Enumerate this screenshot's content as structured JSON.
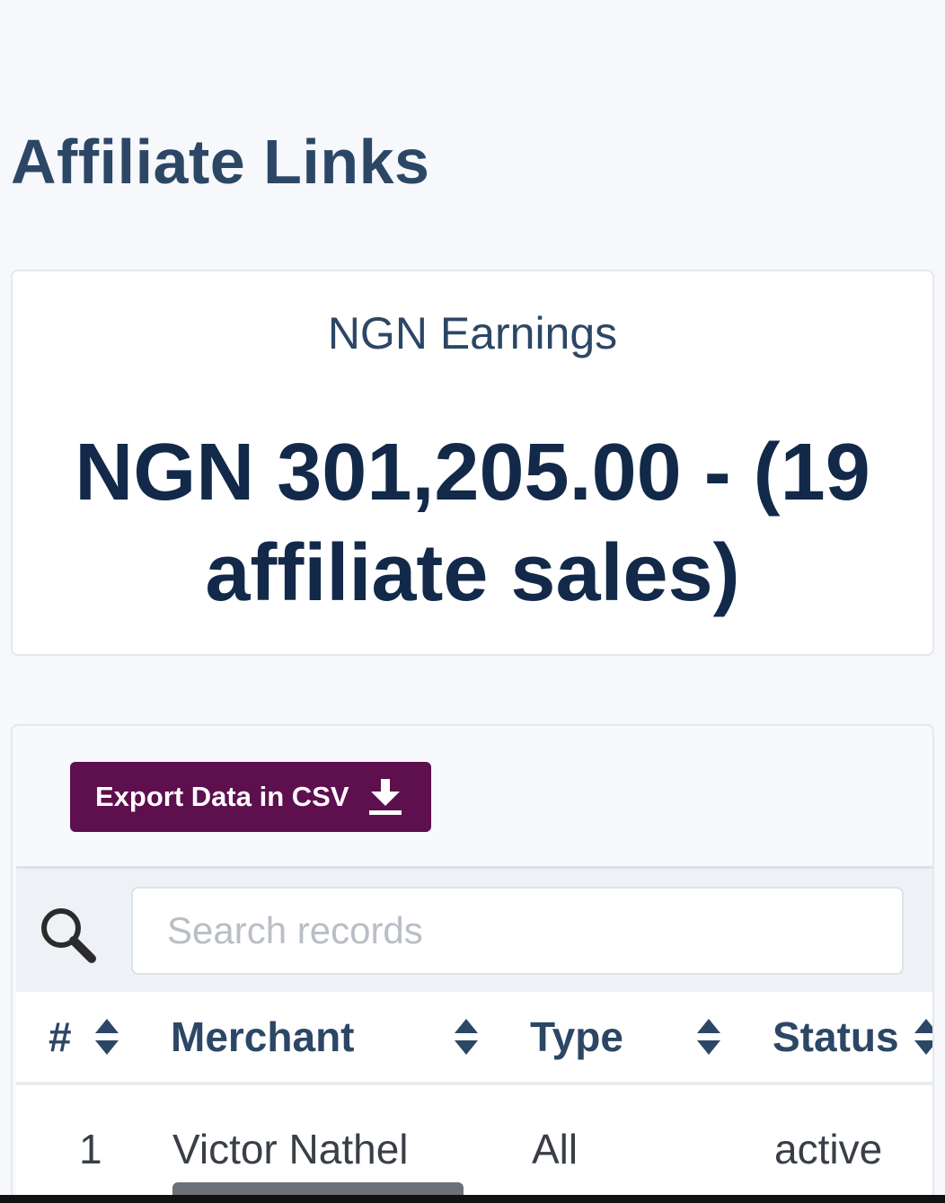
{
  "page": {
    "title": "Affiliate Links"
  },
  "earnings": {
    "label": "NGN Earnings",
    "value": "NGN 301,205.00 - (19 affiliate sales)"
  },
  "toolbar": {
    "export_label": "Export Data in CSV",
    "export_icon": "download-icon",
    "accent_color": "#5e0f4e"
  },
  "search": {
    "icon": "search-icon",
    "placeholder": "Search records"
  },
  "table": {
    "columns": [
      {
        "label": "#",
        "sort_icon": "sort-icon"
      },
      {
        "label": "Merchant",
        "sort_icon": "sort-icon"
      },
      {
        "label": "Type",
        "sort_icon": "sort-icon"
      },
      {
        "label": "Status",
        "sort_icon": "sort-icon"
      }
    ],
    "rows": [
      {
        "index": "1",
        "merchant": "Victor Nathel",
        "type": "All",
        "status": "active"
      }
    ]
  }
}
